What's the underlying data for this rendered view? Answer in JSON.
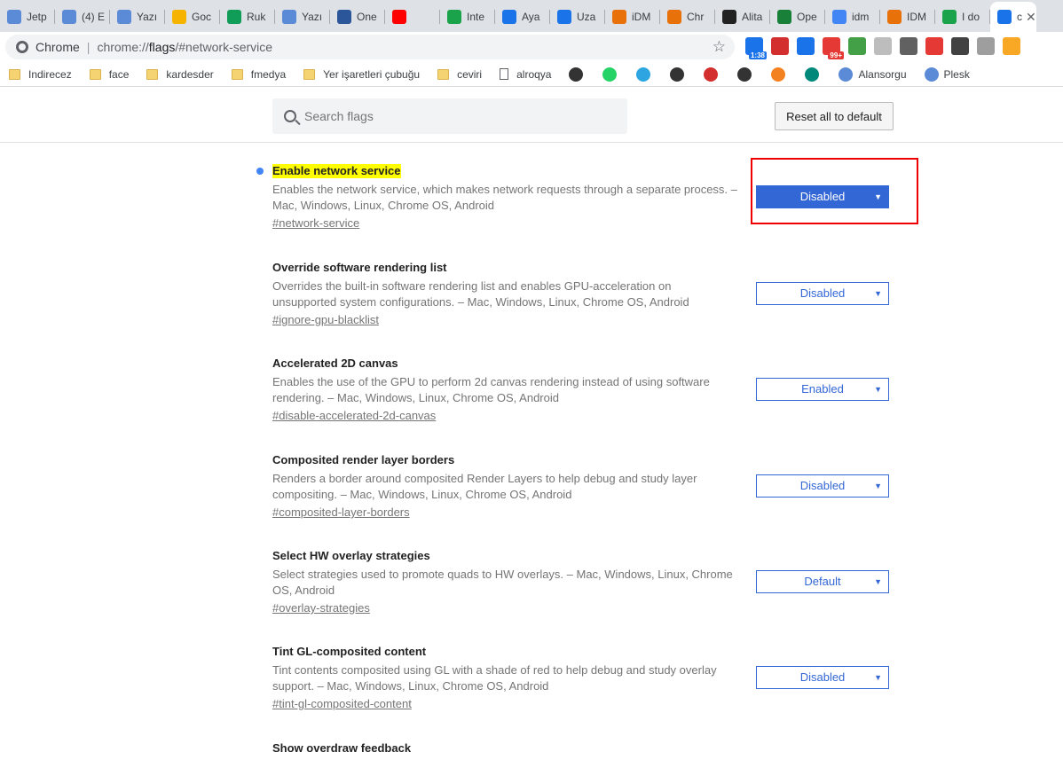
{
  "tabs": [
    {
      "label": "Jetp",
      "color": "#5b8ad6"
    },
    {
      "label": "(4) E",
      "color": "#5b8ad6"
    },
    {
      "label": "Yazı",
      "color": "#5b8ad6"
    },
    {
      "label": "Goc",
      "color": "#f6b400"
    },
    {
      "label": "Ruk",
      "color": "#0f9d58"
    },
    {
      "label": "Yazı",
      "color": "#5b8ad6"
    },
    {
      "label": "One",
      "color": "#2b579a"
    },
    {
      "label": "",
      "color": "#ff0000"
    },
    {
      "label": "Inte",
      "color": "#1aa34a"
    },
    {
      "label": "Aya",
      "color": "#1a73e8"
    },
    {
      "label": "Uza",
      "color": "#1a73e8"
    },
    {
      "label": "iDM",
      "color": "#e8710a"
    },
    {
      "label": "Chr",
      "color": "#e8710a"
    },
    {
      "label": "Alita",
      "color": "#222222"
    },
    {
      "label": "Ope",
      "color": "#188038"
    },
    {
      "label": "idm",
      "color": "#4285f4"
    },
    {
      "label": "IDM",
      "color": "#e8710a"
    },
    {
      "label": "I do",
      "color": "#1aa34a"
    }
  ],
  "active_tab": {
    "label": "c",
    "close": "✕"
  },
  "toolbar": {
    "site": "Chrome",
    "url_prefix": "chrome://",
    "url_host": "flags",
    "url_rest": "/#network-service",
    "star": "☆"
  },
  "extensions": [
    {
      "color": "#1a73e8",
      "badge": "1:38",
      "badge_color": "#1a73e8"
    },
    {
      "color": "#d32f2f",
      "badge": "",
      "badge_color": ""
    },
    {
      "color": "#1a73e8",
      "badge": "",
      "badge_color": ""
    },
    {
      "color": "#e53935",
      "badge": "99+",
      "badge_color": "#e53935"
    },
    {
      "color": "#43a047",
      "badge": "",
      "badge_color": ""
    },
    {
      "color": "#bdbdbd",
      "badge": "",
      "badge_color": ""
    },
    {
      "color": "#616161",
      "badge": "",
      "badge_color": ""
    },
    {
      "color": "#e53935",
      "badge": "",
      "badge_color": ""
    },
    {
      "color": "#424242",
      "badge": "",
      "badge_color": ""
    },
    {
      "color": "#9e9e9e",
      "badge": "",
      "badge_color": ""
    },
    {
      "color": "#f9a825",
      "badge": "",
      "badge_color": ""
    }
  ],
  "bookmarks": [
    {
      "type": "folder",
      "label": "Indirecez"
    },
    {
      "type": "folder",
      "label": "face"
    },
    {
      "type": "folder",
      "label": "kardesder"
    },
    {
      "type": "folder",
      "label": "fmedya"
    },
    {
      "type": "folder",
      "label": "Yer işaretleri çubuğu"
    },
    {
      "type": "folder",
      "label": "ceviri"
    },
    {
      "type": "page",
      "label": "alroqya"
    },
    {
      "type": "icon",
      "label": "",
      "color": "#333333"
    },
    {
      "type": "icon",
      "label": "",
      "color": "#25d366"
    },
    {
      "type": "icon",
      "label": "",
      "color": "#2ca5e0"
    },
    {
      "type": "icon",
      "label": "",
      "color": "#333333"
    },
    {
      "type": "icon",
      "label": "",
      "color": "#d32f2f"
    },
    {
      "type": "icon",
      "label": "",
      "color": "#333333"
    },
    {
      "type": "icon",
      "label": "",
      "color": "#f48120"
    },
    {
      "type": "icon",
      "label": "",
      "color": "#00897b"
    },
    {
      "type": "icon",
      "label": "Alansorgu",
      "color": "#5b8ad6"
    },
    {
      "type": "icon",
      "label": "Plesk",
      "color": "#5b8ad6"
    }
  ],
  "header": {
    "search_placeholder": "Search flags",
    "reset_label": "Reset all to default"
  },
  "flags": [
    {
      "title": "Enable network service",
      "desc": "Enables the network service, which makes network requests through a separate process. – Mac, Windows, Linux, Chrome OS, Android",
      "link": "#network-service",
      "value": "Disabled"
    },
    {
      "title": "Override software rendering list",
      "desc": "Overrides the built-in software rendering list and enables GPU-acceleration on unsupported system configurations. – Mac, Windows, Linux, Chrome OS, Android",
      "link": "#ignore-gpu-blacklist",
      "value": "Disabled"
    },
    {
      "title": "Accelerated 2D canvas",
      "desc": "Enables the use of the GPU to perform 2d canvas rendering instead of using software rendering. – Mac, Windows, Linux, Chrome OS, Android",
      "link": "#disable-accelerated-2d-canvas",
      "value": "Enabled"
    },
    {
      "title": "Composited render layer borders",
      "desc": "Renders a border around composited Render Layers to help debug and study layer compositing. – Mac, Windows, Linux, Chrome OS, Android",
      "link": "#composited-layer-borders",
      "value": "Disabled"
    },
    {
      "title": "Select HW overlay strategies",
      "desc": "Select strategies used to promote quads to HW overlays. – Mac, Windows, Linux, Chrome OS, Android",
      "link": "#overlay-strategies",
      "value": "Default"
    },
    {
      "title": "Tint GL-composited content",
      "desc": "Tint contents composited using GL with a shade of red to help debug and study overlay support. – Mac, Windows, Linux, Chrome OS, Android",
      "link": "#tint-gl-composited-content",
      "value": "Disabled"
    },
    {
      "title": "Show overdraw feedback",
      "desc": "",
      "link": "",
      "value": ""
    }
  ],
  "caret": "▼"
}
